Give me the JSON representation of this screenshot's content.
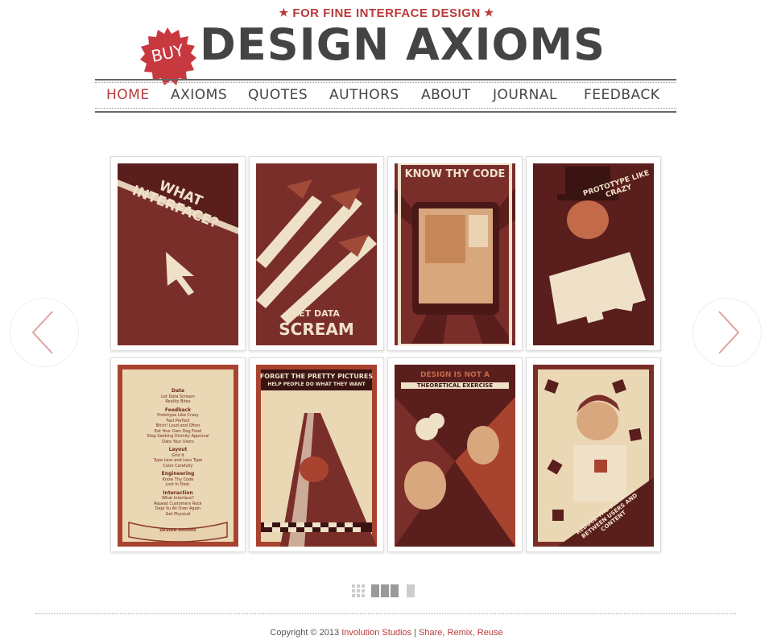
{
  "header": {
    "tagline_star": "★",
    "tagline": "FOR FINE INTERFACE DESIGN",
    "logo": "DESIGN AXIOMS",
    "buy_label": "BUY"
  },
  "nav": {
    "items": [
      "HOME",
      "AXIOMS",
      "QUOTES",
      "AUTHORS",
      "ABOUT",
      "JOURNAL",
      "FEEDBACK"
    ],
    "active": "HOME"
  },
  "posters": [
    {
      "title": "WHAT INTERFACE?"
    },
    {
      "title": "LET DATA",
      "title2": "SCREAM"
    },
    {
      "title": "KNOW THY CODE"
    },
    {
      "title": "PROTOTYPE LIKE CRAZY"
    },
    {
      "title": "DESIGN AXIOMS",
      "sections": [
        {
          "heading": "Data",
          "items": [
            "Let Data Scream",
            "Reality Bites"
          ]
        },
        {
          "heading": "Feedback",
          "items": [
            "Prototype Like Crazy",
            "Fast Perfect",
            "Bitch! Loud and Often",
            "Eat Your Own Dog Food",
            "Stop Seeking Divinity Approval",
            "Date Your Users"
          ]
        },
        {
          "heading": "Layout",
          "items": [
            "Grid It",
            "Type Less and Less Type",
            "Color Carefully"
          ]
        },
        {
          "heading": "Engineering",
          "items": [
            "Know Thy Code",
            "Lost In Dest."
          ]
        },
        {
          "heading": "Interaction",
          "items": [
            "What Interface?",
            "Repeat Customers Rock",
            "Deja Vu All Over Again",
            "Get Physical"
          ]
        }
      ]
    },
    {
      "title": "FORGET THE PRETTY PICTURES",
      "title2": "HELP PEOPLE DO WHAT THEY WANT"
    },
    {
      "title": "DESIGN IS NOT A",
      "title2": "THEORETICAL EXERCISE"
    },
    {
      "title": "REDUCE THE DISTANCE BETWEEN USERS AND CONTENT"
    }
  ],
  "footer": {
    "copyright": "Copyright © 2013",
    "company": "Involution Studios",
    "divider": "|",
    "share": "Share, Remix, Reuse"
  },
  "colors": {
    "accent": "#b93a3a",
    "poster_dark": "#5a1e1c",
    "poster_mid": "#7a2e2a",
    "poster_light": "#efe1c8"
  }
}
